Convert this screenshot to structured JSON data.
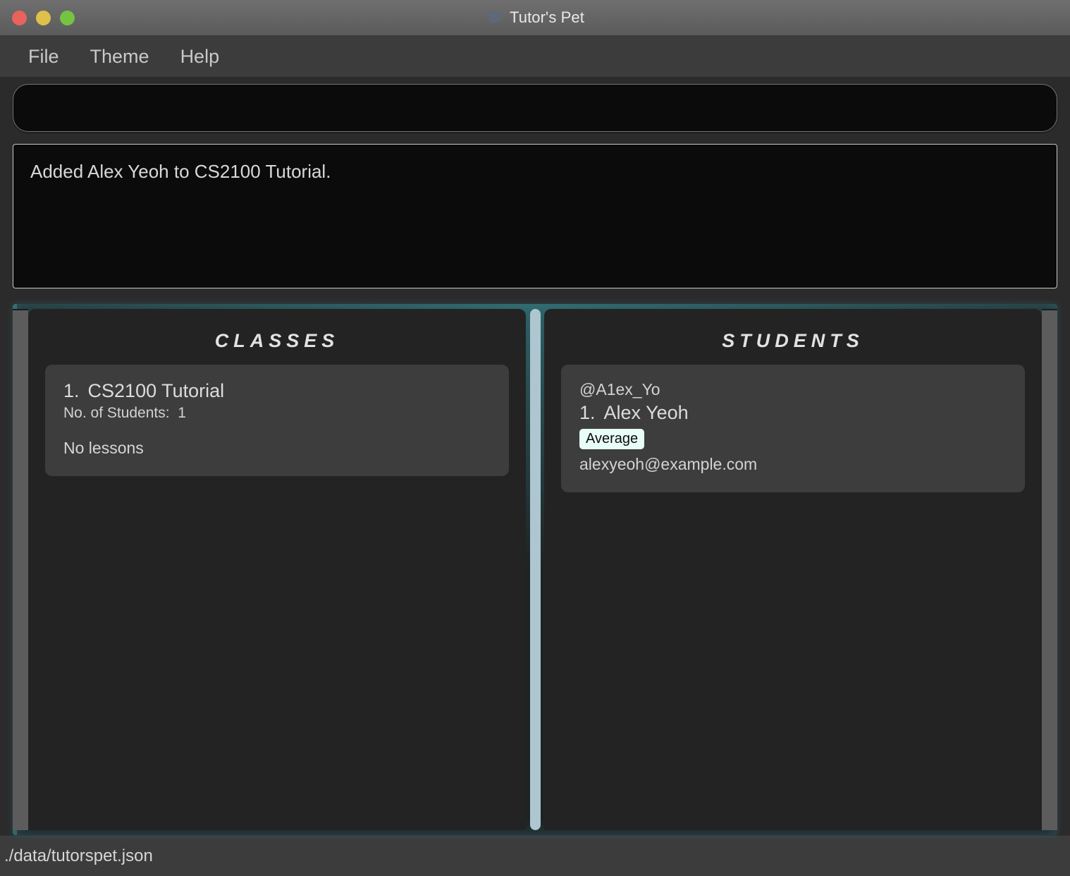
{
  "window": {
    "title": "Tutor's Pet",
    "app_icon": "graduation-cap-icon",
    "controls": {
      "close_color": "#e8635c",
      "minimize_color": "#e0c04a",
      "zoom_color": "#76c242"
    }
  },
  "menubar": {
    "items": [
      {
        "label": "File"
      },
      {
        "label": "Theme"
      },
      {
        "label": "Help"
      }
    ]
  },
  "command": {
    "value": "",
    "placeholder": ""
  },
  "result": {
    "text": "Added Alex Yeoh to CS2100 Tutorial."
  },
  "panels": {
    "classes": {
      "title": "CLASSES",
      "cards": [
        {
          "index": "1.",
          "name": "CS2100 Tutorial",
          "students_label": "No. of Students:",
          "students_count": "1",
          "lessons": "No lessons"
        }
      ]
    },
    "students": {
      "title": "STUDENTS",
      "cards": [
        {
          "handle": "@A1ex_Yo",
          "index": "1.",
          "name": "Alex Yeoh",
          "tags": [
            "Average"
          ],
          "email": "alexyeoh@example.com"
        }
      ]
    }
  },
  "statusbar": {
    "file_path": "./data/tutorspet.json"
  },
  "theme": {
    "accent_glow": "#3a969e",
    "splitter": "#adc6d0",
    "tag_background": "#e8fcf8",
    "card_background": "#3d3d3d",
    "panel_background": "#232323"
  }
}
